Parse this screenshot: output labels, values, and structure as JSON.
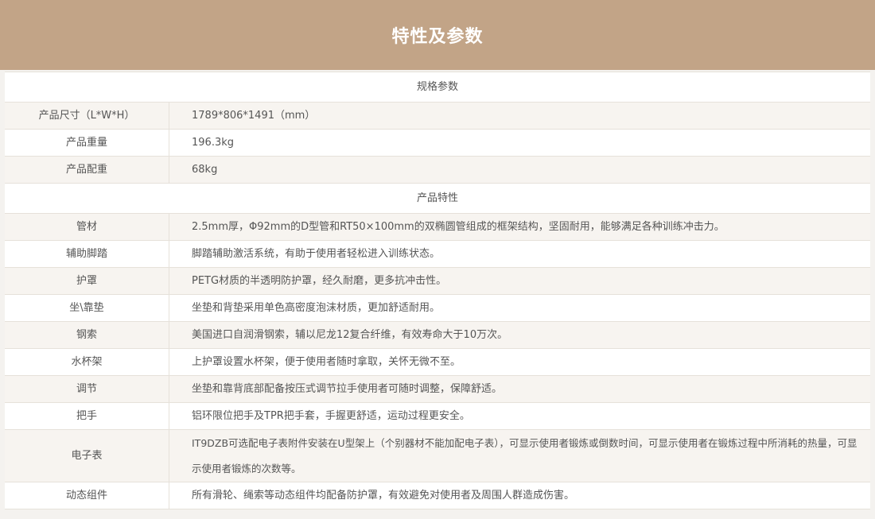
{
  "banner": {
    "title": "特性及参数"
  },
  "specs": {
    "heading": "规格参数",
    "rows": [
      {
        "label": "产品尺寸（L*W*H）",
        "value": "1789*806*1491（mm）"
      },
      {
        "label": "产品重量",
        "value": "196.3kg"
      },
      {
        "label": "产品配重",
        "value": "68kg"
      }
    ]
  },
  "features": {
    "heading": "产品特性",
    "rows": [
      {
        "label": "管材",
        "value": "2.5mm厚，Φ92mm的D型管和RT50×100mm的双椭圆管组成的框架结构，坚固耐用，能够满足各种训练冲击力。"
      },
      {
        "label": "辅助脚踏",
        "value": "脚踏辅助激活系统，有助于使用者轻松进入训练状态。"
      },
      {
        "label": "护罩",
        "value": "PETG材质的半透明防护罩，经久耐磨，更多抗冲击性。"
      },
      {
        "label": "坐\\靠垫",
        "value": "坐垫和背垫采用单色高密度泡沫材质，更加舒适耐用。"
      },
      {
        "label": "钢索",
        "value": "美国进口自润滑钢索，辅以尼龙12复合纤维，有效寿命大于10万次。"
      },
      {
        "label": "水杯架",
        "value": "上护罩设置水杯架，便于使用者随时拿取，关怀无微不至。"
      },
      {
        "label": "调节",
        "value": "坐垫和靠背底部配备按压式调节拉手使用者可随时调整，保障舒适。"
      },
      {
        "label": "把手",
        "value": "铝环限位把手及TPR把手套，手握更舒适，运动过程更安全。"
      },
      {
        "label": "电子表",
        "value": "IT9DZB可选配电子表附件安装在U型架上（个别器材不能加配电子表），可显示使用者锻炼或倒数时间，可显示使用者在锻炼过程中所消耗的热量，可显示使用者锻炼的次数等。"
      },
      {
        "label": "动态组件",
        "value": "所有滑轮、绳索等动态组件均配备防护罩，有效避免对使用者及周围人群造成伤害。"
      }
    ]
  }
}
